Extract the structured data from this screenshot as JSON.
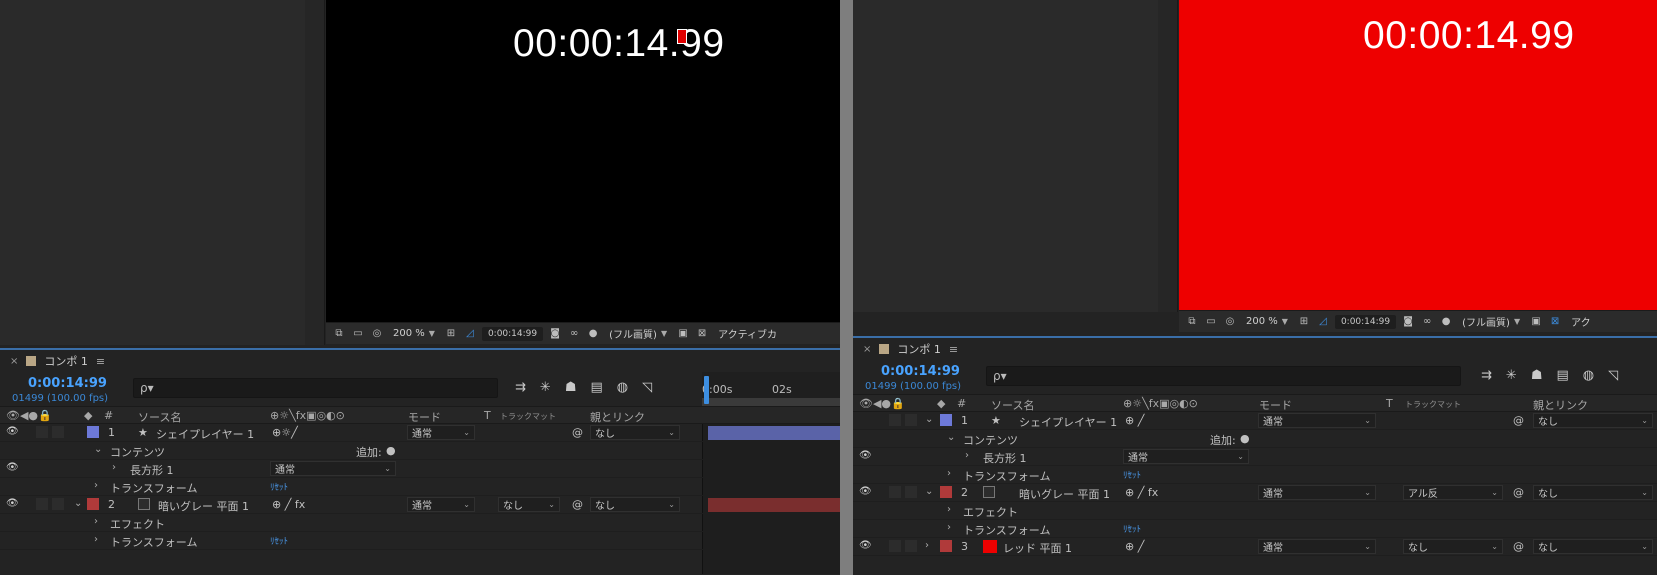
{
  "left": {
    "viewer": {
      "timecode": "00:00:14.99",
      "background": "#000000",
      "zoom": "200 %",
      "time": "0:00:14:99",
      "resolution": "(フル画質)",
      "active_camera": "アクティブカ"
    },
    "timeline": {
      "comp_name": "コンポ 1",
      "current_time": "0:00:14:99",
      "frames": "01499 (100.00 fps)",
      "search_placeholder": "ρ▾",
      "ruler": {
        "t0": "0:00s",
        "t1": "02s"
      },
      "columns": {
        "source_name": "ソース名",
        "mode": "モード",
        "t": "T",
        "trackmatte": "トラックマット",
        "parent": "親とリンク",
        "num": "#"
      },
      "rows": [
        {
          "type": "layer",
          "num": "1",
          "name": "シェイプレイヤー 1",
          "color": "#6d79d8",
          "mode": "通常",
          "parent": "なし"
        },
        {
          "type": "group",
          "name": "コンテンツ",
          "add": "追加:"
        },
        {
          "type": "sub",
          "name": "長方形 1",
          "mode": "通常"
        },
        {
          "type": "group",
          "name": "トランスフォーム",
          "reset": "ﾘｾｯﾄ"
        },
        {
          "type": "layer",
          "num": "2",
          "name": "暗いグレー 平面 1",
          "color": "#b03a3a",
          "mode": "通常",
          "matte": "なし",
          "parent": "なし"
        },
        {
          "type": "group",
          "name": "エフェクト"
        },
        {
          "type": "group",
          "name": "トランスフォーム",
          "reset": "ﾘｾｯﾄ"
        }
      ]
    }
  },
  "right": {
    "viewer": {
      "timecode": "00:00:14.99",
      "background": "#ee0000",
      "zoom": "200 %",
      "time": "0:00:14:99",
      "resolution": "(フル画質)",
      "active_camera": "アク"
    },
    "timeline": {
      "comp_name": "コンポ 1",
      "current_time": "0:00:14:99",
      "frames": "01499 (100.00 fps)",
      "search_placeholder": "ρ▾",
      "columns": {
        "source_name": "ソース名",
        "mode": "モード",
        "t": "T",
        "trackmatte": "トラックマット",
        "parent": "親とリンク",
        "num": "#"
      },
      "rows": [
        {
          "type": "layer",
          "num": "1",
          "name": "シェイプレイヤー 1",
          "color": "#6d79d8",
          "mode": "通常",
          "parent": "なし"
        },
        {
          "type": "group",
          "name": "コンテンツ",
          "add": "追加:"
        },
        {
          "type": "sub",
          "name": "長方形 1",
          "mode": "通常"
        },
        {
          "type": "group",
          "name": "トランスフォーム",
          "reset": "ﾘｾｯﾄ"
        },
        {
          "type": "layer",
          "num": "2",
          "name": "暗いグレー 平面 1",
          "color": "#b03a3a",
          "mode": "通常",
          "matte": "アル反",
          "parent": "なし"
        },
        {
          "type": "group",
          "name": "エフェクト"
        },
        {
          "type": "group",
          "name": "トランスフォーム",
          "reset": "ﾘｾｯﾄ"
        },
        {
          "type": "layer",
          "num": "3",
          "name": "レッド 平面 1",
          "color": "#b03a3a",
          "chip": "#ee0000",
          "mode": "通常",
          "matte": "なし",
          "parent": "なし"
        }
      ]
    }
  }
}
